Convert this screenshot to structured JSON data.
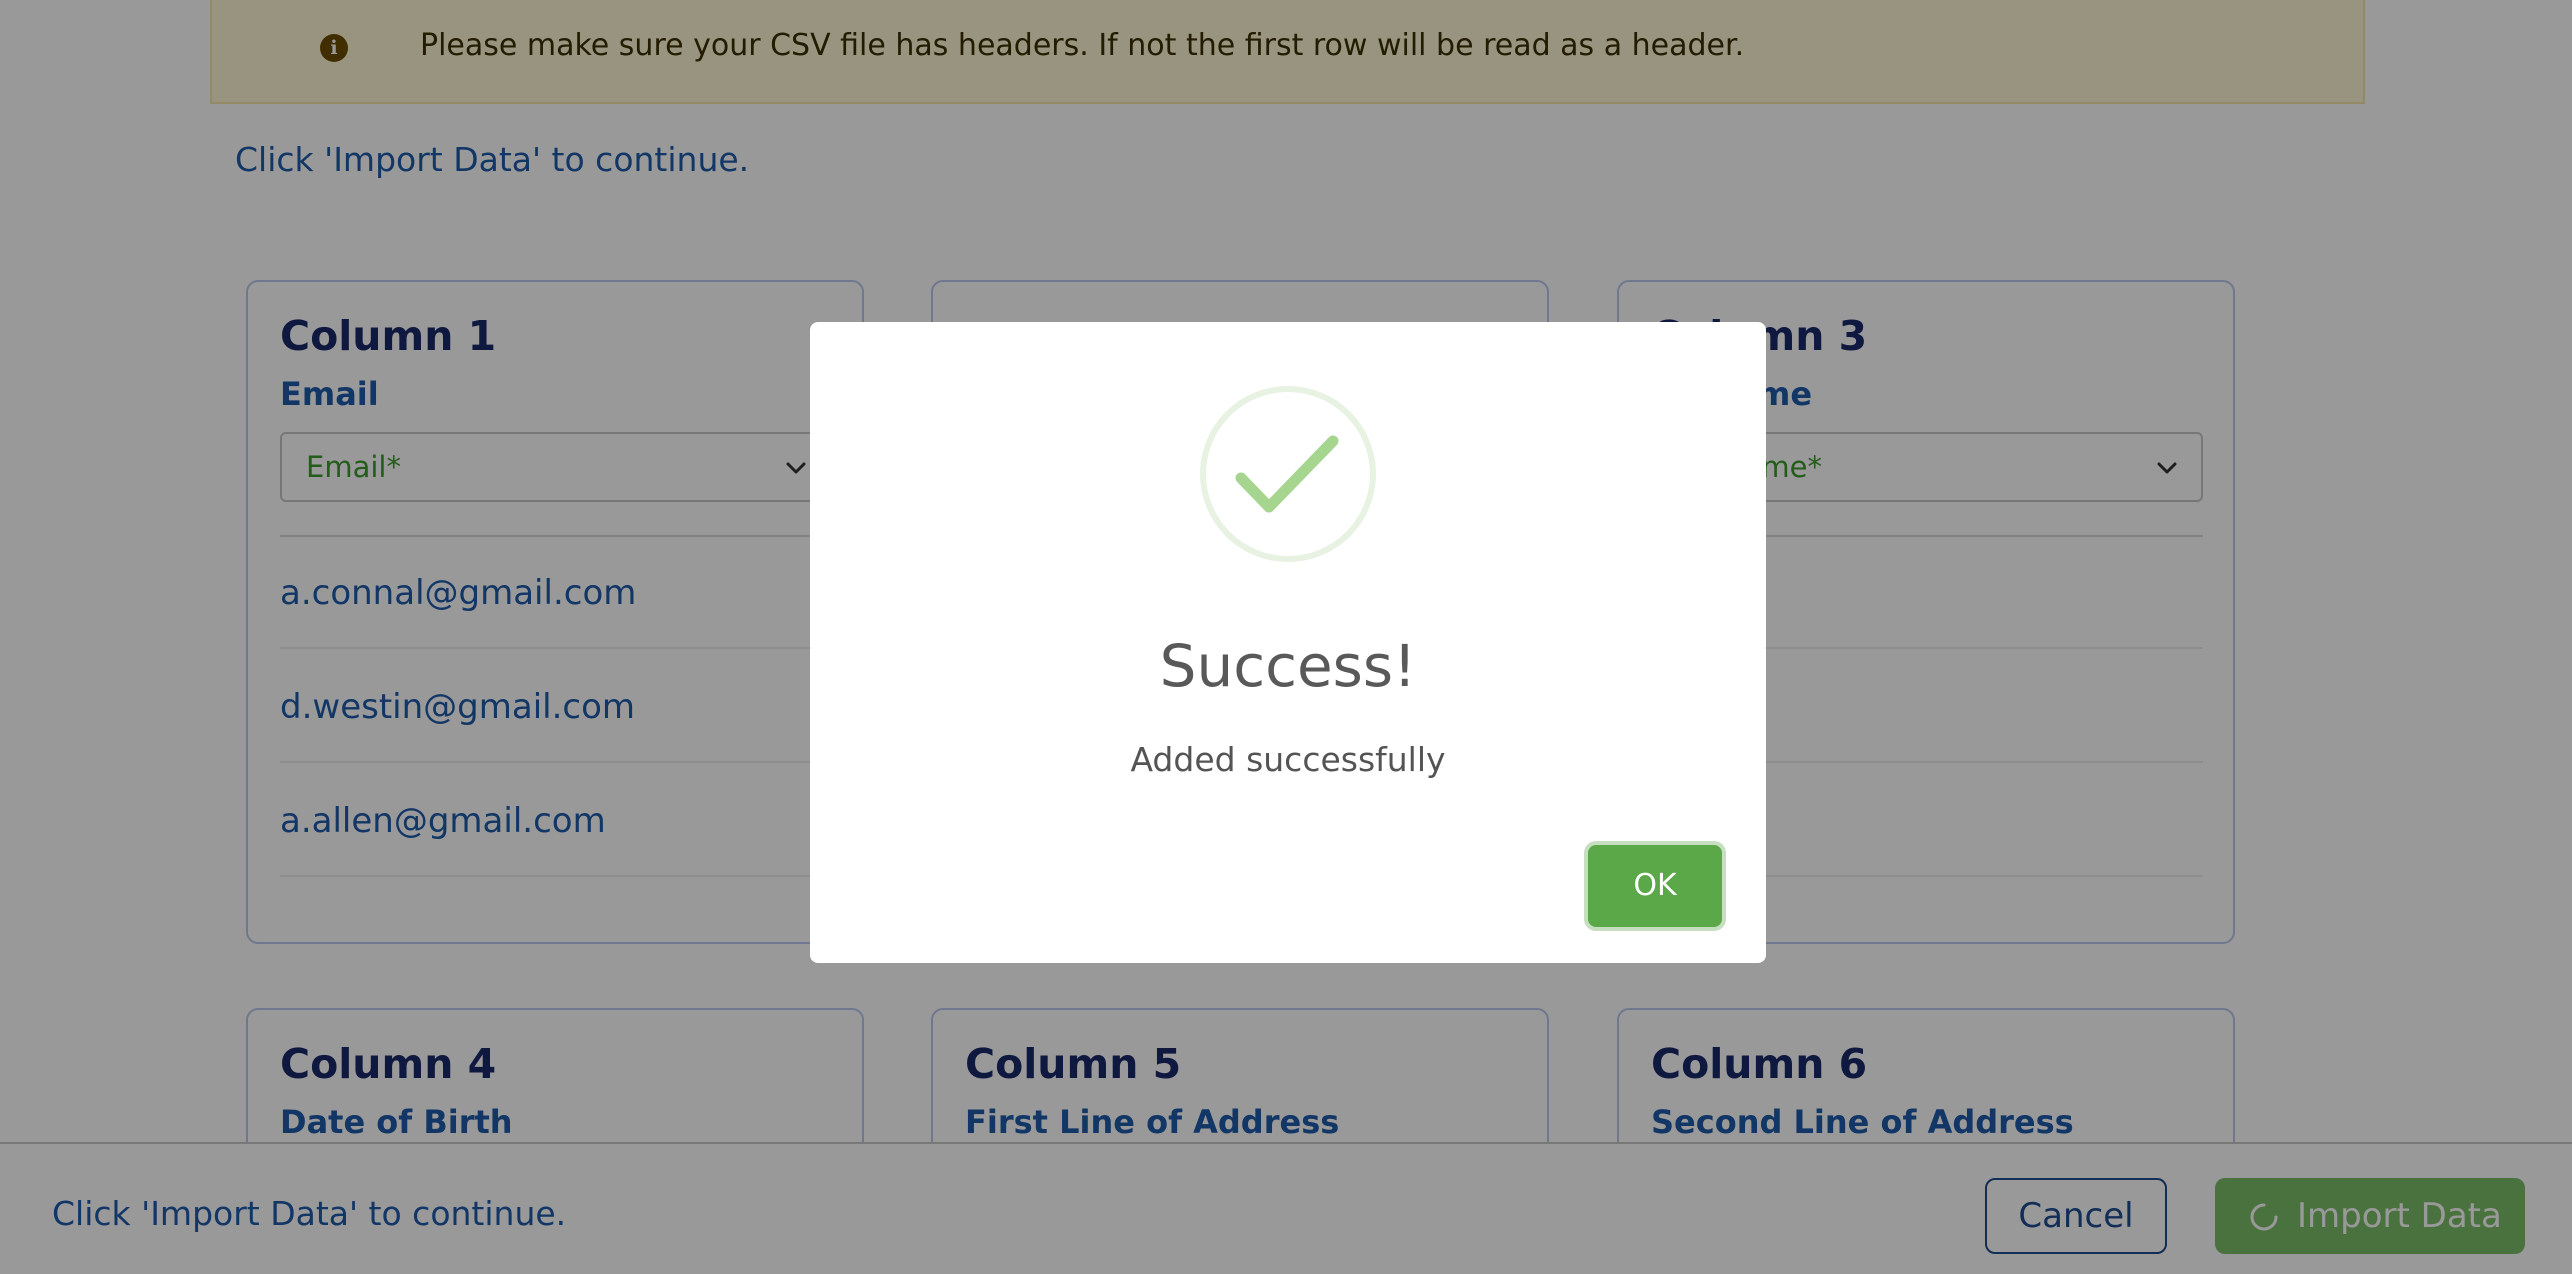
{
  "banner": {
    "icon": "info-circle-icon",
    "text": "Please make sure your CSV file has headers. If not the first row will be read as a header."
  },
  "hint_top": "Click 'Import Data' to continue.",
  "columns": [
    {
      "title": "Column 1",
      "field": "Email",
      "select_value": "Email*",
      "rows": [
        "a.connal@gmail.com",
        "d.westin@gmail.com",
        "a.allen@gmail.com"
      ]
    },
    {
      "title": "Column 3",
      "field": "Surname",
      "select_value": "Surname*",
      "rows": []
    },
    {
      "title": "Column 4",
      "field": "Date of Birth"
    },
    {
      "title": "Column 5",
      "field": "First Line of Address"
    },
    {
      "title": "Column 6",
      "field": "Second Line of Address"
    }
  ],
  "footer": {
    "hint": "Click 'Import Data' to continue.",
    "cancel_label": "Cancel",
    "import_label": "Import Data"
  },
  "modal": {
    "icon": "success-check-icon",
    "title": "Success!",
    "message": "Added successfully",
    "ok_label": "OK"
  },
  "colors": {
    "accent_blue": "#1e4d91",
    "success_green": "#5aa847",
    "banner_bg": "#fff7d6"
  }
}
